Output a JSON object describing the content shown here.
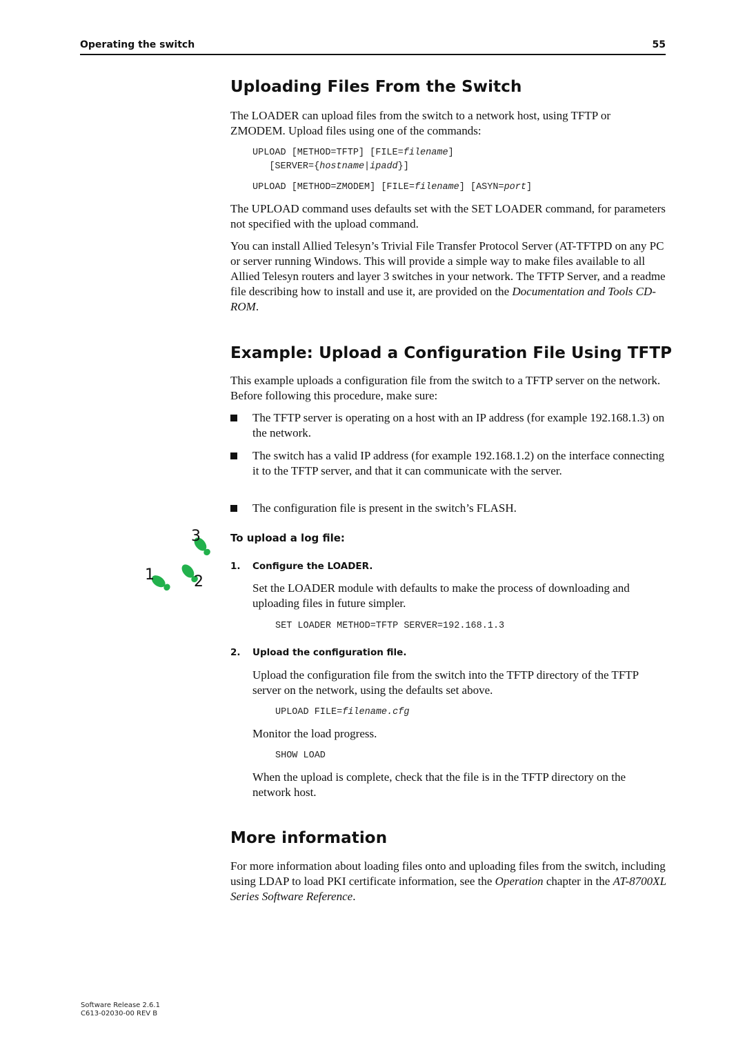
{
  "header": {
    "section_title": "Operating the switch",
    "page_number": "55"
  },
  "sections": {
    "uploading": {
      "heading": "Uploading Files From the Switch",
      "intro": "The LOADER can upload files from the switch to a network host, using TFTP or ZMODEM. Upload files using one of the commands:",
      "cmd1_line1_a": "UPLOAD [METHOD=TFTP] [FILE=",
      "cmd1_line1_var": "filename",
      "cmd1_line1_b": "]",
      "cmd1_line2_a": "[SERVER={",
      "cmd1_line2_var1": "hostname",
      "cmd1_line2_sep": "|",
      "cmd1_line2_var2": "ipadd",
      "cmd1_line2_b": "}]",
      "cmd2_a": "UPLOAD [METHOD=ZMODEM] [FILE=",
      "cmd2_var1": "filename",
      "cmd2_b": "] [ASYN=",
      "cmd2_var2": "port",
      "cmd2_c": "]",
      "defaults_para": "The UPLOAD command uses defaults set with the SET LOADER command, for parameters not specified with the upload command.",
      "tftpd_para_a": "You can install Allied Telesyn’s Trivial File Transfer Protocol Server (AT-TFTPD on any PC or server running Windows. This will provide a simple way to make files available to all Allied Telesyn routers and layer 3 switches in your network. The TFTP Server, and a readme file describing how to install and use it, are provided on the ",
      "tftpd_para_em": "Documentation and Tools CD-ROM",
      "tftpd_para_b": "."
    },
    "example": {
      "heading": "Example: Upload a Configuration File Using TFTP",
      "intro": "This example uploads a configuration file from the switch to a TFTP server on the network. Before following this procedure, make sure:",
      "bullets": [
        "The TFTP server is operating on a host with an IP address (for example 192.168.1.3) on the network.",
        "The switch has a valid IP address (for example 192.168.1.2) on the interface connecting it to the TFTP server, and that it can communicate with the server.",
        "The configuration file is present in the switch’s FLASH."
      ],
      "procedure_title": "To upload a log file:",
      "steps_icon": "footsteps-icon",
      "step_icon_numbers": [
        "1",
        "2",
        "3"
      ],
      "steps": [
        {
          "number": "1.",
          "title": "Configure the LOADER.",
          "body": "Set the LOADER module with defaults to make the process of downloading and uploading files in future simpler.",
          "command": "SET LOADER METHOD=TFTP SERVER=192.168.1.3"
        },
        {
          "number": "2.",
          "title": "Upload the configuration file.",
          "body": "Upload the configuration file from the switch into the TFTP directory of the TFTP server on the network, using the defaults set above.",
          "command_a": "UPLOAD FILE=",
          "command_var": "filename.cfg",
          "monitor_text": "Monitor the load progress.",
          "monitor_command": "SHOW LOAD",
          "complete_text": "When the upload is complete, check that the file is in the TFTP directory on the network host."
        }
      ]
    },
    "more_info": {
      "heading": "More information",
      "para_a": "For more information about loading files onto and uploading files from the switch, including using LDAP to load PKI certificate information, see the ",
      "para_em1": "Operation",
      "para_b": " chapter in the ",
      "para_em2": "AT-8700XL Series Software Reference",
      "para_c": "."
    }
  },
  "footer": {
    "line1": "Software Release 2.6.1",
    "line2": "C613-02030-00 REV B"
  },
  "colors": {
    "footstep_green": "#22b14c"
  }
}
